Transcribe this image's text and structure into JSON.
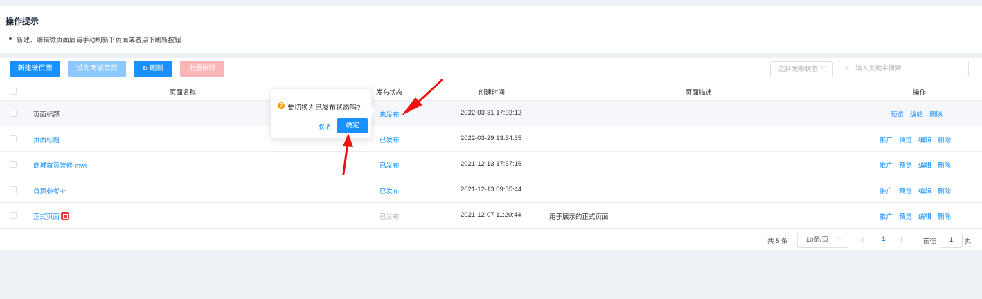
{
  "tips": {
    "title": "操作提示",
    "item": "新建、编辑微页面后请手动刷新下页面或者点下刷新按钮"
  },
  "toolbar": {
    "new_label": "新建微页面",
    "set_home_label": "设为商城首页",
    "refresh_label": "刷新",
    "batch_delete_label": "批量删除",
    "status_select_placeholder": "选择发布状态",
    "search_placeholder": "输入关键字搜索"
  },
  "table": {
    "headers": {
      "name": "页面名称",
      "status": "发布状态",
      "created": "创建时间",
      "desc": "页面描述",
      "ops": "操作"
    },
    "rows": [
      {
        "name": "页面标题",
        "status": "未发布",
        "created": "2022-03-31 17:02:12",
        "desc": "",
        "ops": [
          "预览",
          "编辑",
          "删除"
        ]
      },
      {
        "name": "页面标题",
        "status": "已发布",
        "created": "2022-03-29 13:34:35",
        "desc": "",
        "ops": [
          "推广",
          "预览",
          "编辑",
          "删除"
        ]
      },
      {
        "name": "商城首页装修-mwl",
        "status": "已发布",
        "created": "2021-12-13 17:57:15",
        "desc": "",
        "ops": [
          "推广",
          "预览",
          "编辑",
          "删除"
        ]
      },
      {
        "name": "首页参考-lq",
        "status": "已发布",
        "created": "2021-12-13 09:35:44",
        "desc": "",
        "ops": [
          "推广",
          "预览",
          "编辑",
          "删除"
        ]
      },
      {
        "name": "正式页面",
        "status": "已发布",
        "created": "2021-12-07 11:20:44",
        "desc": "用于展示的正式页面",
        "ops": [
          "推广",
          "预览",
          "编辑",
          "删除"
        ]
      }
    ]
  },
  "pagination": {
    "total": "共 5 条",
    "page_size": "10条/页",
    "current": "1",
    "goto_label": "前往",
    "goto_value": "1",
    "page_suffix": "页",
    "prev": "‹",
    "next": "›"
  },
  "popover": {
    "message": "要切换为已发布状态吗?",
    "cancel_label": "取消",
    "confirm_label": "确定"
  },
  "colors": {
    "primary": "#1890ff",
    "annotation_arrow": "#ee1111",
    "warning": "#ff9900"
  }
}
